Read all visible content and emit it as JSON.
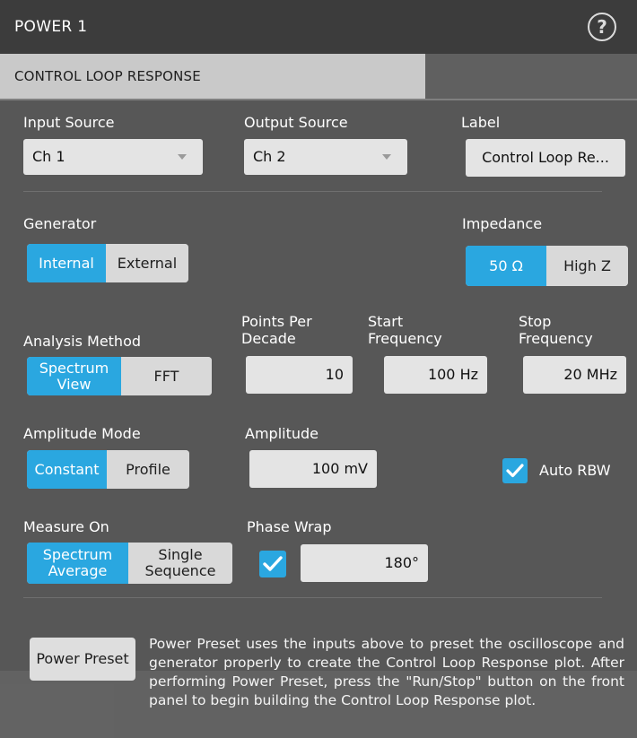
{
  "window": {
    "title": "POWER 1",
    "help_glyph": "?"
  },
  "tab": {
    "label": "CONTROL LOOP RESPONSE"
  },
  "input_source": {
    "label": "Input Source",
    "value": "Ch 1"
  },
  "output_source": {
    "label": "Output Source",
    "value": "Ch 2"
  },
  "label_field": {
    "label": "Label",
    "value": "Control Loop Re..."
  },
  "generator": {
    "label": "Generator",
    "options": [
      "Internal",
      "External"
    ],
    "selected": "Internal"
  },
  "impedance": {
    "label": "Impedance",
    "options": [
      "50 Ω",
      "High Z"
    ],
    "selected": "50 Ω"
  },
  "analysis_method": {
    "label": "Analysis Method",
    "options": [
      "Spectrum View",
      "FFT"
    ],
    "selected": "Spectrum View"
  },
  "points_per_decade": {
    "label_line1": "Points Per",
    "label_line2": "Decade",
    "value": "10"
  },
  "start_frequency": {
    "label_line1": "Start",
    "label_line2": "Frequency",
    "value": "100 Hz"
  },
  "stop_frequency": {
    "label_line1": "Stop",
    "label_line2": "Frequency",
    "value": "20 MHz"
  },
  "amplitude_mode": {
    "label": "Amplitude Mode",
    "options": [
      "Constant",
      "Profile"
    ],
    "selected": "Constant"
  },
  "amplitude": {
    "label": "Amplitude",
    "value": "100 mV"
  },
  "auto_rbw": {
    "label": "Auto RBW",
    "checked": true
  },
  "measure_on": {
    "label": "Measure On",
    "options": [
      "Spectrum Average",
      "Single Sequence"
    ],
    "selected": "Spectrum Average"
  },
  "phase_wrap": {
    "label": "Phase Wrap",
    "checked": true,
    "value": "180°"
  },
  "power_preset": {
    "button_label": "Power Preset",
    "description": "Power Preset uses the inputs above to preset the oscilloscope and generator properly to create the Control Loop Response plot. After performing Power Preset, press the \"Run/Stop\" button on the front panel to begin building the Control Loop Response plot."
  },
  "colors": {
    "accent": "#2aa7e0",
    "panel": "#575757",
    "titlebar": "#3c3c3c",
    "control": "#e4e4e4"
  }
}
